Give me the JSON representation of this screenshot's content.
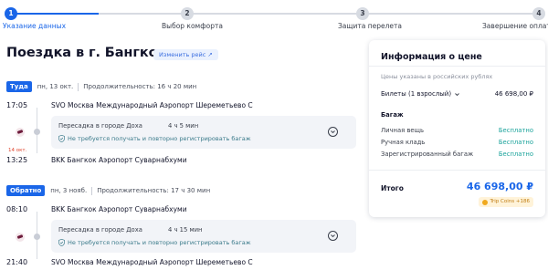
{
  "stepper": {
    "steps": [
      {
        "num": "1",
        "label": "Указание данных"
      },
      {
        "num": "2",
        "label": "Выбор комфорта"
      },
      {
        "num": "3",
        "label": "Защита перелета"
      },
      {
        "num": "4",
        "label": "Завершение оплаты"
      }
    ],
    "active_index": 0,
    "active_color": "#1a66e8"
  },
  "header": {
    "title": "Поездка в г. Бангкок",
    "change_label": "Изменить рейс"
  },
  "outbound": {
    "direction": "Туда",
    "date": "пн, 13 окт.",
    "duration": "Продолжительность: 16 ч 20 мин",
    "dep_time": "17:05",
    "dep_airport": "SVO Москва Международный Аэропорт Шереметьево С",
    "transfer_title": "Пересадка в городе Доха",
    "transfer_duration": "4 ч 5 мин",
    "transfer_note": "Не требуется получать и повторно регистрировать багаж",
    "arr_date": "14 окт.",
    "arr_time": "13:25",
    "arr_airport": "BKK Бангкок Аэропорт Суварнабхуми"
  },
  "return": {
    "direction": "Обратно",
    "date": "пн, 3 нояб.",
    "duration": "Продолжительность: 17 ч 30 мин",
    "dep_time": "08:10",
    "dep_airport": "BKK Бангкок Аэропорт Суварнабхуми",
    "transfer_title": "Пересадка в городе Доха",
    "transfer_duration": "4 ч 15 мин",
    "transfer_note": "Не требуется получать и повторно регистрировать багаж",
    "arr_time": "21:40",
    "arr_airport": "SVO Москва Международный Аэропорт Шереметьево С"
  },
  "price": {
    "title": "Информация о цене",
    "note": "Цены указаны в российских рублях",
    "tickets_label": "Билеты (1 взрослый)",
    "tickets_value": "46 698,00 ₽",
    "baggage_title": "Багаж",
    "baggage_rows": [
      {
        "label": "Личная вещь",
        "value": "Бесплатно"
      },
      {
        "label": "Ручная кладь",
        "value": "Бесплатно"
      },
      {
        "label": "Зарегистрированный багаж",
        "value": "Бесплатно"
      }
    ],
    "total_label": "Итого",
    "total_value": "46 698,00 ₽",
    "coins": "Trip Coins +186"
  }
}
